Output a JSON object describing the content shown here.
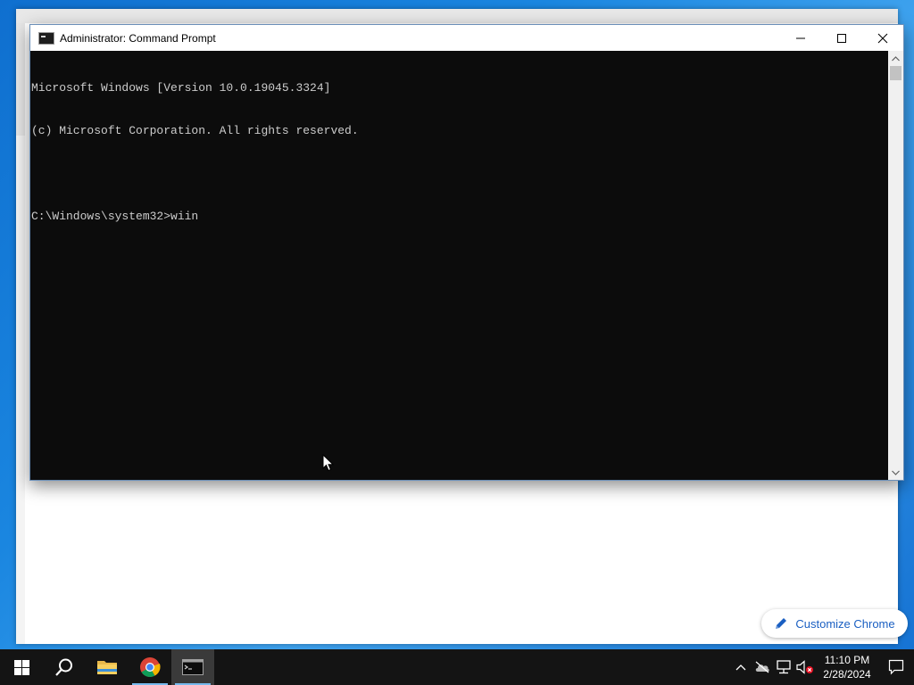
{
  "cmd": {
    "title": "Administrator: Command Prompt",
    "lines": [
      "Microsoft Windows [Version 10.0.19045.3324]",
      "(c) Microsoft Corporation. All rights reserved.",
      "",
      "C:\\Windows\\system32>wiin"
    ]
  },
  "chrome": {
    "customize_label": "Customize Chrome"
  },
  "taskbar": {
    "clock_time": "11:10 PM",
    "clock_date": "2/28/2024",
    "apps": [
      "start-button",
      "search",
      "file-explorer",
      "chrome",
      "command-prompt"
    ]
  },
  "colors": {
    "console_bg": "#0c0c0c",
    "console_text": "#cccccc",
    "taskbar_bg": "#141414",
    "accent": "#76b9ed",
    "chrome_link": "#1a5fc2"
  }
}
